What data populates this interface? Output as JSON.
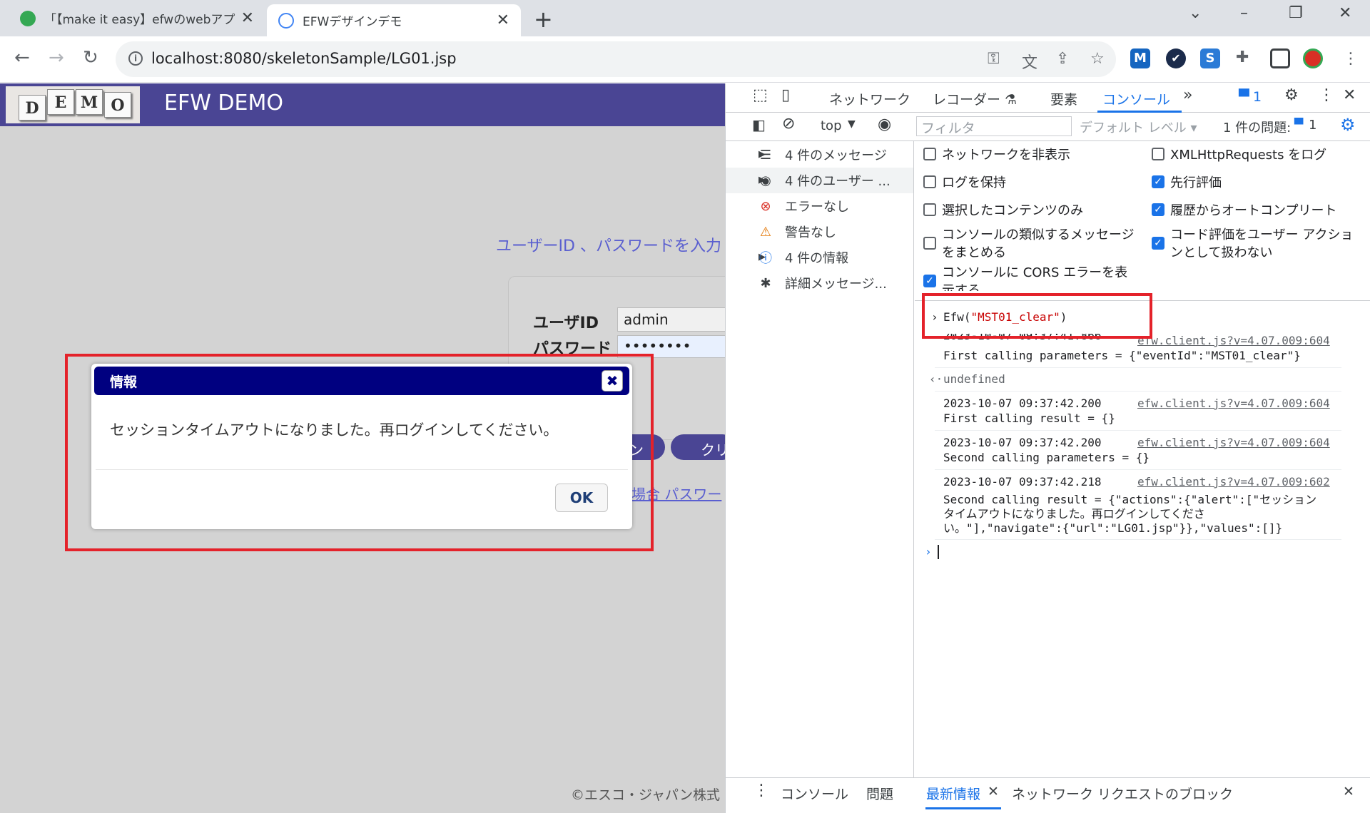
{
  "browser": {
    "tabs": [
      {
        "title": "「【make it easy】efwのwebアプリの",
        "active": false,
        "favicon_color": "#34a853"
      },
      {
        "title": "EFWデザインデモ",
        "active": true,
        "favicon_color": "#4285f4"
      }
    ],
    "url": "localhost:8080/skeletonSample/LG01.jsp",
    "window_buttons": {
      "collapse": "⌄",
      "minimize": "–",
      "restore": "❐",
      "close": "✕"
    }
  },
  "page": {
    "logo_letters": [
      "D",
      "E",
      "M",
      "O"
    ],
    "app_title": "EFW DEMO",
    "login_hint": "ユーザーID 、パスワードを入力",
    "user_label": "ユーザID",
    "user_value": "admin",
    "pass_label": "パスワード",
    "pass_value": "••••••••",
    "login_button_partial": "ン",
    "clear_button_partial": "クリ",
    "forgot_link": "場合 パスワー",
    "copyright": "©エスコ・ジャパン株式"
  },
  "dialog": {
    "title": "情報",
    "close_label": "✖",
    "message": "セッションタイムアウトになりました。再ログインしてください。",
    "ok_label": "OK"
  },
  "devtools": {
    "tabs": [
      "ネットワーク",
      "レコーダー ⚗",
      "要素",
      "コンソール",
      "»"
    ],
    "issue_badge": "1",
    "context": "top",
    "filter_placeholder": "フィルタ",
    "level": "デフォルト レベル ▾",
    "issues_label": "1 件の問題:",
    "issues_count": "1",
    "sidebar": [
      {
        "label": "4 件のメッセージ",
        "icon": "list-icon",
        "glyph": "☰",
        "color": "#3c4043"
      },
      {
        "label": "4 件のユーザー ...",
        "icon": "user-icon",
        "glyph": "◉",
        "color": "#3c4043"
      },
      {
        "label": "エラーなし",
        "icon": "error-icon",
        "glyph": "⊗",
        "color": "#d93025"
      },
      {
        "label": "警告なし",
        "icon": "warning-icon",
        "glyph": "⚠",
        "color": "#e37400"
      },
      {
        "label": "4 件の情報",
        "icon": "info-icon",
        "glyph": "ⓘ",
        "color": "#1a73e8"
      },
      {
        "label": "詳細メッセージ...",
        "icon": "bug-icon",
        "glyph": "✱",
        "color": "#3c4043"
      }
    ],
    "settings_left": [
      {
        "label": "ネットワークを非表示",
        "checked": false
      },
      {
        "label": "ログを保持",
        "checked": false
      },
      {
        "label": "選択したコンテンツのみ",
        "checked": false
      },
      {
        "label": "コンソールの類似するメッセージ",
        "label2": "をまとめる",
        "checked": false
      },
      {
        "label": "コンソールに CORS エラーを表",
        "label2": "示する",
        "checked": true
      }
    ],
    "settings_right": [
      {
        "label": "XMLHttpRequests をログ",
        "checked": false
      },
      {
        "label": "先行評価",
        "checked": true
      },
      {
        "label": "履歴からオートコンプリート",
        "checked": true
      },
      {
        "label": "コード評価をユーザー アクショ",
        "label2": "ンとして扱わない",
        "checked": true
      }
    ],
    "console": {
      "input_prefix": "Efw(",
      "input_string": "\"MST01_clear\"",
      "input_suffix": ")",
      "partial_time": "2023-10-07 09:37:41.866",
      "entries": [
        {
          "time": "",
          "source": "efw.client.js?v=4.07.009:604",
          "text": "First calling parameters = {\"eventId\":\"MST01_clear\"}"
        },
        {
          "time": "2023-10-07 09:37:42.200",
          "source": "efw.client.js?v=4.07.009:604",
          "text": "First calling result = {}"
        },
        {
          "time": "2023-10-07 09:37:42.200",
          "source": "efw.client.js?v=4.07.009:604",
          "text": "Second calling parameters = {}"
        },
        {
          "time": "2023-10-07 09:37:42.218",
          "source": "efw.client.js?v=4.07.009:602",
          "text": "Second calling result = {\"actions\":{\"alert\":[\"セッション",
          "text2": "タイムアウトになりました。再ログインしてくださ",
          "text3": "い。\"],\"navigate\":{\"url\":\"LG01.jsp\"}},\"values\":[]}"
        }
      ],
      "return_value": "undefined"
    },
    "drawer_tabs": [
      "コンソール",
      "問題",
      "最新情報",
      "ネットワーク リクエストのブロック"
    ]
  }
}
